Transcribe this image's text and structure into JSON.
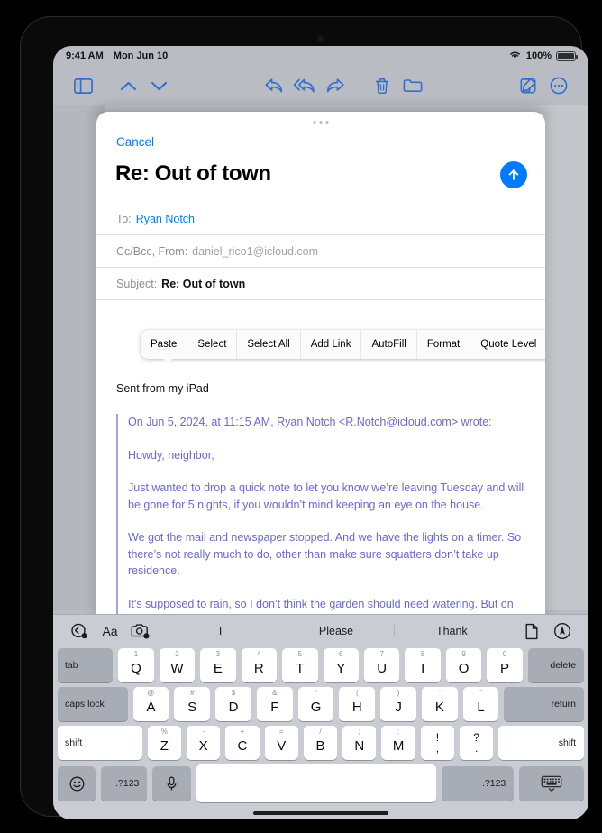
{
  "status_bar": {
    "time": "9:41 AM",
    "date": "Mon Jun 10",
    "battery_percent": "100%",
    "wifi_icon": "wifi-icon",
    "battery_icon": "battery-icon"
  },
  "mail_toolbar": {
    "icons": [
      {
        "name": "sidebar-toggle-icon",
        "label": "Sidebar"
      },
      {
        "name": "chevron-up-icon",
        "label": "Previous Message"
      },
      {
        "name": "chevron-down-icon",
        "label": "Next Message"
      },
      {
        "name": "reply-icon",
        "label": "Reply"
      },
      {
        "name": "reply-all-icon",
        "label": "Reply All"
      },
      {
        "name": "forward-icon",
        "label": "Forward"
      },
      {
        "name": "trash-icon",
        "label": "Delete"
      },
      {
        "name": "folder-icon",
        "label": "Move to Folder"
      },
      {
        "name": "compose-icon",
        "label": "New Message"
      },
      {
        "name": "more-options-icon",
        "label": "More"
      }
    ]
  },
  "compose": {
    "cancel_label": "Cancel",
    "title": "Re: Out of town",
    "send_icon": "send-arrow-up-icon",
    "fields": {
      "to_label": "To:",
      "to_value": "Ryan Notch",
      "cc_label": "Cc/Bcc, From:",
      "cc_value": "daniel_rico1@icloud.com",
      "subject_label": "Subject:",
      "subject_value": "Re: Out of town"
    },
    "context_menu": {
      "items": [
        "Paste",
        "Select",
        "Select All",
        "Add Link",
        "AutoFill",
        "Format",
        "Quote Level"
      ],
      "more_chevron": "›"
    },
    "body": {
      "signature": "Sent from my iPad",
      "quoted_paragraphs": [
        "On Jun 5, 2024, at 11:15 AM, Ryan Notch <R.Notch@icloud.com> wrote:",
        "Howdy, neighbor,",
        "Just wanted to drop a quick note to let you know we’re leaving Tuesday and will be gone for 5 nights, if you wouldn’t mind keeping an eye on the house.",
        "We got the mail and newspaper stopped. And we have the lights on a timer. So there’s not really much to do, other than make sure squatters don’t take up residence.",
        "It's supposed to rain, so I don’t think the garden should need watering. But on the"
      ]
    }
  },
  "keyboard": {
    "predictive_bar": {
      "left_icons": [
        {
          "name": "format-undo-icon"
        },
        {
          "name": "text-style-aa-icon",
          "label": "Aa"
        },
        {
          "name": "camera-insert-icon"
        }
      ],
      "predictions": [
        "I",
        "Please",
        "Thank"
      ],
      "right_icons": [
        {
          "name": "document-insert-icon"
        },
        {
          "name": "markup-pen-icon"
        }
      ]
    },
    "row1": [
      {
        "name": "tab-key",
        "main": "tab",
        "type": "mod-dark",
        "flex": 1.35
      },
      {
        "name": "key-q",
        "main": "Q",
        "alt": "1",
        "type": "letter"
      },
      {
        "name": "key-w",
        "main": "W",
        "alt": "2",
        "type": "letter"
      },
      {
        "name": "key-e",
        "main": "E",
        "alt": "3",
        "type": "letter"
      },
      {
        "name": "key-r",
        "main": "R",
        "alt": "4",
        "type": "letter"
      },
      {
        "name": "key-t",
        "main": "T",
        "alt": "5",
        "type": "letter"
      },
      {
        "name": "key-y",
        "main": "Y",
        "alt": "6",
        "type": "letter"
      },
      {
        "name": "key-u",
        "main": "U",
        "alt": "7",
        "type": "letter"
      },
      {
        "name": "key-i",
        "main": "I",
        "alt": "8",
        "type": "letter"
      },
      {
        "name": "key-o",
        "main": "O",
        "alt": "9",
        "type": "letter"
      },
      {
        "name": "key-p",
        "main": "P",
        "alt": "0",
        "type": "letter"
      },
      {
        "name": "delete-key",
        "main": "delete",
        "type": "mod-dark",
        "flex": 1.35
      }
    ],
    "row2": [
      {
        "name": "caps-lock-key",
        "main": "caps lock",
        "type": "mod-dark",
        "flex": 1.75
      },
      {
        "name": "key-a",
        "main": "A",
        "alt": "@",
        "type": "letter"
      },
      {
        "name": "key-s",
        "main": "S",
        "alt": "#",
        "type": "letter"
      },
      {
        "name": "key-d",
        "main": "D",
        "alt": "$",
        "type": "letter"
      },
      {
        "name": "key-f",
        "main": "F",
        "alt": "&",
        "type": "letter"
      },
      {
        "name": "key-g",
        "main": "G",
        "alt": "*",
        "type": "letter"
      },
      {
        "name": "key-h",
        "main": "H",
        "alt": "(",
        "type": "letter"
      },
      {
        "name": "key-j",
        "main": "J",
        "alt": ")",
        "type": "letter"
      },
      {
        "name": "key-k",
        "main": "K",
        "alt": "’",
        "type": "letter"
      },
      {
        "name": "key-l",
        "main": "L",
        "alt": "”",
        "type": "letter"
      },
      {
        "name": "return-key",
        "main": "return",
        "type": "mod-dark",
        "flex": 2.0
      }
    ],
    "row3": [
      {
        "name": "shift-left-key",
        "main": "shift",
        "type": "mod-light",
        "flex": 2.3
      },
      {
        "name": "key-z",
        "main": "Z",
        "alt": "%",
        "type": "letter"
      },
      {
        "name": "key-x",
        "main": "X",
        "alt": "-",
        "type": "letter"
      },
      {
        "name": "key-c",
        "main": "C",
        "alt": "+",
        "type": "letter"
      },
      {
        "name": "key-v",
        "main": "V",
        "alt": "=",
        "type": "letter"
      },
      {
        "name": "key-b",
        "main": "B",
        "alt": "/",
        "type": "letter"
      },
      {
        "name": "key-n",
        "main": "N",
        "alt": ";",
        "type": "letter"
      },
      {
        "name": "key-m",
        "main": "M",
        "alt": ":",
        "type": "letter"
      },
      {
        "name": "key-exclaim-comma",
        "top": "!",
        "bot": ",",
        "type": "dual"
      },
      {
        "name": "key-question-period",
        "top": "?",
        "bot": ".",
        "type": "dual"
      },
      {
        "name": "shift-right-key",
        "main": "shift",
        "type": "mod-light",
        "flex": 2.3
      }
    ],
    "row4": [
      {
        "name": "emoji-key",
        "main": "☺",
        "type": "mod-dark",
        "flex": 1.0
      },
      {
        "name": "numbers-left-key",
        "main": ".?123",
        "type": "mod-dark",
        "flex": 1.0
      },
      {
        "name": "dictation-key",
        "main": "mic",
        "type": "mod-dark",
        "flex": 1.0
      },
      {
        "name": "space-key",
        "main": "",
        "type": "space",
        "flex": 6.3
      },
      {
        "name": "numbers-right-key",
        "main": ".?123",
        "type": "mod-dark",
        "flex": 1.7
      },
      {
        "name": "dismiss-keyboard-key",
        "main": "keyboard",
        "type": "mod-dark",
        "flex": 1.7
      }
    ]
  },
  "colors": {
    "accent_blue": "#007aff",
    "toolbar_blue": "#2f6fd0",
    "quote_purple": "#6a68d8",
    "keyboard_bg": "#c9ccd2"
  }
}
